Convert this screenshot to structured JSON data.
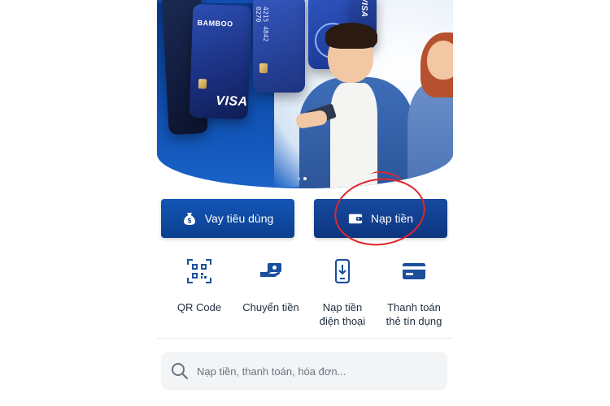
{
  "banner": {
    "brand_label": "BAMBOO",
    "card_brand": "VISA",
    "card_logo_text": "ki",
    "card_number_fragment": "4215 4842 0270",
    "slides_total": 2,
    "slide_active": 2
  },
  "actions": {
    "loan_label": "Vay tiêu dùng",
    "topup_label": "Nạp tiền"
  },
  "quick_menu": [
    {
      "icon": "qr-code-icon",
      "label": "QR Code"
    },
    {
      "icon": "money-transfer-icon",
      "label": "Chuyển tiền"
    },
    {
      "icon": "phone-topup-icon",
      "label": "Nạp tiền\nđiện thoại"
    },
    {
      "icon": "credit-card-icon",
      "label": "Thanh toán\nthẻ tín dụng"
    }
  ],
  "search": {
    "placeholder": "Nạp tiền, thanh toán, hóa đơn..."
  },
  "colors": {
    "primary": "#0b3f8f",
    "accent_icon": "#1b4f9c",
    "highlight_circle": "#e0262b"
  }
}
